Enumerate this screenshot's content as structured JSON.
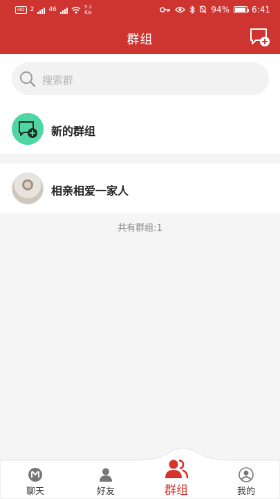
{
  "status_bar": {
    "badge": "HD",
    "sim": "2",
    "net": "46",
    "speed_value": "5.1",
    "speed_unit": "K/s",
    "battery": "94%",
    "time": "6:41"
  },
  "header": {
    "title": "群组",
    "action_icon": "add-chat-icon"
  },
  "search": {
    "placeholder": "搜索群"
  },
  "new_group": {
    "label": "新的群组",
    "color": "#4fd6a3"
  },
  "groups": [
    {
      "name": "相亲相爱一家人"
    }
  ],
  "group_count_text": "共有群组:1",
  "nav": {
    "items": [
      {
        "label": "聊天",
        "icon": "chat-m-icon"
      },
      {
        "label": "好友",
        "icon": "person-icon"
      },
      {
        "label": "群组",
        "icon": "group-icon",
        "active": true
      },
      {
        "label": "我的",
        "icon": "profile-icon"
      }
    ],
    "active_color": "#d7322d"
  },
  "colors": {
    "brand": "#cf3530",
    "background": "#f5f5f5"
  }
}
